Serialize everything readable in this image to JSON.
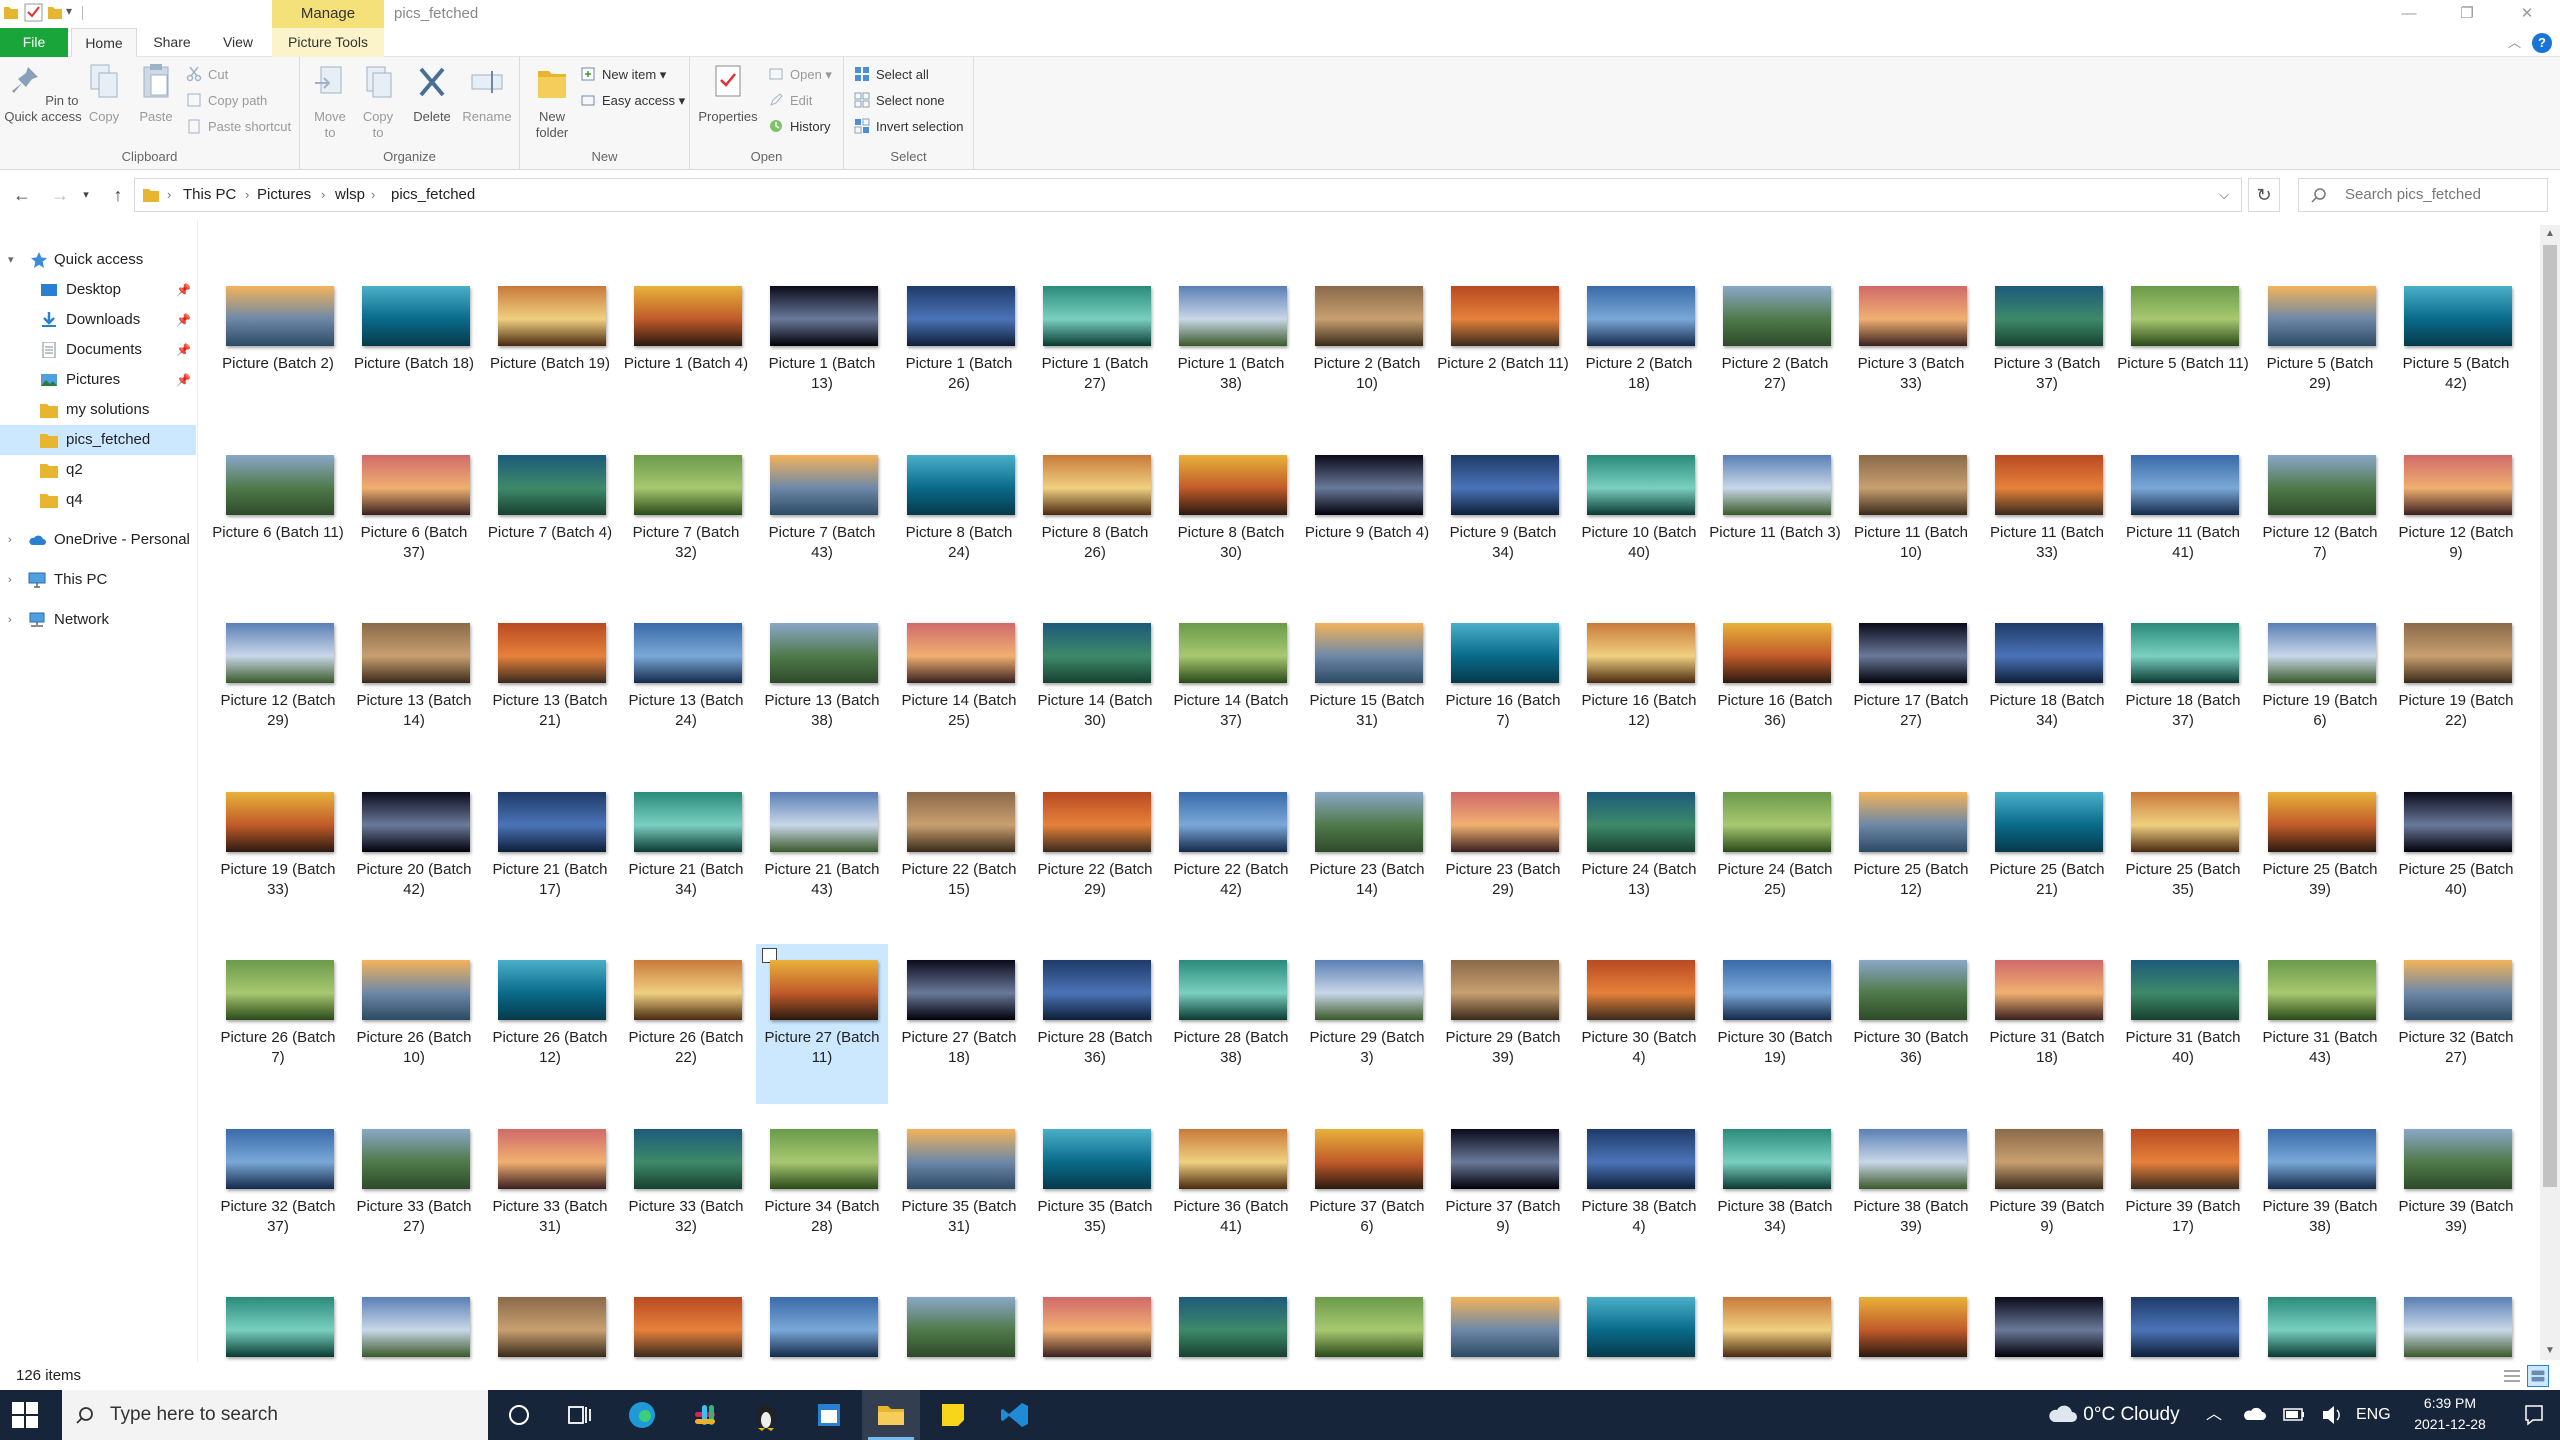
{
  "window": {
    "title": "pics_fetched",
    "manage_label": "Manage"
  },
  "ribbon_tabs": {
    "file": "File",
    "home": "Home",
    "share": "Share",
    "view": "View",
    "picture_tools": "Picture Tools"
  },
  "ribbon": {
    "clipboard": {
      "group": "Clipboard",
      "pin": "Pin to Quick access",
      "copy": "Copy",
      "paste": "Paste",
      "cut": "Cut",
      "copy_path": "Copy path",
      "paste_shortcut": "Paste shortcut"
    },
    "organize": {
      "group": "Organize",
      "move_to": "Move to",
      "copy_to": "Copy to",
      "delete": "Delete",
      "rename": "Rename"
    },
    "new": {
      "group": "New",
      "new_folder": "New folder",
      "new_item": "New item",
      "easy_access": "Easy access"
    },
    "open": {
      "group": "Open",
      "properties": "Properties",
      "open": "Open",
      "edit": "Edit",
      "history": "History"
    },
    "select": {
      "group": "Select",
      "select_all": "Select all",
      "select_none": "Select none",
      "invert_selection": "Invert selection"
    }
  },
  "address": {
    "crumbs": [
      "This PC",
      "Pictures",
      "wlsp",
      "pics_fetched"
    ],
    "search_placeholder": "Search pics_fetched"
  },
  "nav": {
    "quick_access": "Quick access",
    "items": [
      "Desktop",
      "Downloads",
      "Documents",
      "Pictures",
      "my solutions",
      "pics_fetched",
      "q2",
      "q4"
    ],
    "onedrive": "OneDrive - Personal",
    "this_pc": "This PC",
    "network": "Network"
  },
  "files": [
    [
      "Picture (Batch 2)",
      "Picture (Batch 18)",
      "Picture (Batch 19)",
      "Picture 1 (Batch 4)",
      "Picture 1 (Batch 13)",
      "Picture 1 (Batch 26)",
      "Picture 1 (Batch 27)",
      "Picture 1 (Batch 38)",
      "Picture 2 (Batch 10)",
      "Picture 2 (Batch 11)",
      "Picture 2 (Batch 18)",
      "Picture 2 (Batch 27)",
      "Picture 3 (Batch 33)",
      "Picture 3 (Batch 37)",
      "Picture 5 (Batch 11)",
      "Picture 5 (Batch 29)",
      "Picture 5 (Batch 42)"
    ],
    [
      "Picture 6 (Batch 11)",
      "Picture 6 (Batch 37)",
      "Picture 7 (Batch 4)",
      "Picture 7 (Batch 32)",
      "Picture 7 (Batch 43)",
      "Picture 8 (Batch 24)",
      "Picture 8 (Batch 26)",
      "Picture 8 (Batch 30)",
      "Picture 9 (Batch 4)",
      "Picture 9 (Batch 34)",
      "Picture 10 (Batch 40)",
      "Picture 11 (Batch 3)",
      "Picture 11 (Batch 10)",
      "Picture 11 (Batch 33)",
      "Picture 11 (Batch 41)",
      "Picture 12 (Batch 7)",
      "Picture 12 (Batch 9)"
    ],
    [
      "Picture 12 (Batch 29)",
      "Picture 13 (Batch 14)",
      "Picture 13 (Batch 21)",
      "Picture 13 (Batch 24)",
      "Picture 13 (Batch 38)",
      "Picture 14 (Batch 25)",
      "Picture 14 (Batch 30)",
      "Picture 14 (Batch 37)",
      "Picture 15 (Batch 31)",
      "Picture 16 (Batch 7)",
      "Picture 16 (Batch 12)",
      "Picture 16 (Batch 36)",
      "Picture 17 (Batch 27)",
      "Picture 18 (Batch 34)",
      "Picture 18 (Batch 37)",
      "Picture 19 (Batch 6)",
      "Picture 19 (Batch 22)"
    ],
    [
      "Picture 19 (Batch 33)",
      "Picture 20 (Batch 42)",
      "Picture 21 (Batch 17)",
      "Picture 21 (Batch 34)",
      "Picture 21 (Batch 43)",
      "Picture 22 (Batch 15)",
      "Picture 22 (Batch 29)",
      "Picture 22 (Batch 42)",
      "Picture 23 (Batch 14)",
      "Picture 23 (Batch 29)",
      "Picture 24 (Batch 13)",
      "Picture 24 (Batch 25)",
      "Picture 25 (Batch 12)",
      "Picture 25 (Batch 21)",
      "Picture 25 (Batch 35)",
      "Picture 25 (Batch 39)",
      "Picture 25 (Batch 40)"
    ],
    [
      "Picture 26 (Batch 7)",
      "Picture 26 (Batch 10)",
      "Picture 26 (Batch 12)",
      "Picture 26 (Batch 22)",
      "Picture 27 (Batch 11)",
      "Picture 27 (Batch 18)",
      "Picture 28 (Batch 36)",
      "Picture 28 (Batch 38)",
      "Picture 29 (Batch 3)",
      "Picture 29 (Batch 39)",
      "Picture 30 (Batch 4)",
      "Picture 30 (Batch 19)",
      "Picture 30 (Batch 36)",
      "Picture 31 (Batch 18)",
      "Picture 31 (Batch 40)",
      "Picture 31 (Batch 43)",
      "Picture 32 (Batch 27)"
    ],
    [
      "Picture 32 (Batch 37)",
      "Picture 33 (Batch 27)",
      "Picture 33 (Batch 31)",
      "Picture 33 (Batch 32)",
      "Picture 34 (Batch 28)",
      "Picture 35 (Batch 31)",
      "Picture 35 (Batch 35)",
      "Picture 36 (Batch 41)",
      "Picture 37 (Batch 6)",
      "Picture 37 (Batch 9)",
      "Picture 38 (Batch 4)",
      "Picture 38 (Batch 34)",
      "Picture 38 (Batch 39)",
      "Picture 39 (Batch 9)",
      "Picture 39 (Batch 17)",
      "Picture 39 (Batch 38)",
      "Picture 39 (Batch 39)"
    ],
    [
      "",
      "",
      "",
      "",
      "",
      "",
      "",
      "",
      "",
      "",
      "",
      "",
      "",
      "",
      "",
      "",
      ""
    ]
  ],
  "selected_file": "Picture 27 (Batch 11)",
  "status": {
    "count": "126 items"
  },
  "taskbar": {
    "search_placeholder": "Type here to search",
    "weather": "0°C  Cloudy",
    "lang": "ENG",
    "time": "6:39 PM",
    "date": "2021-12-28"
  }
}
